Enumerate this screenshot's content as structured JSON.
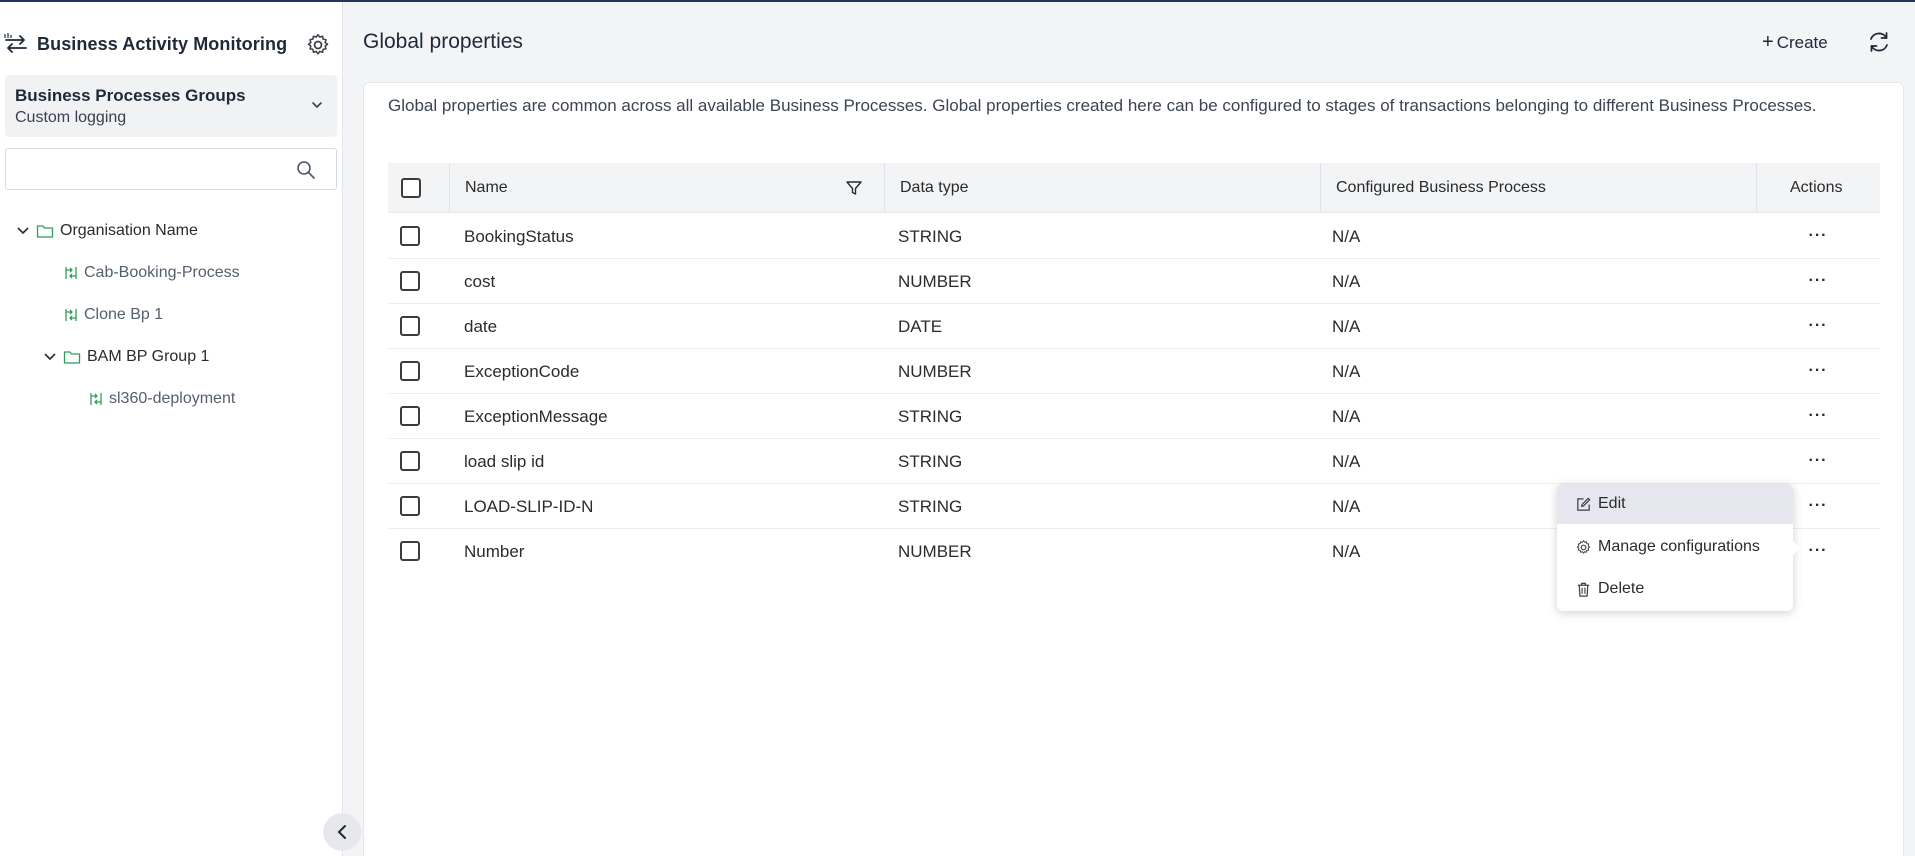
{
  "app": {
    "title": "Business Activity Monitoring",
    "accent_color": "#22355a",
    "bp_icon_color": "#2f9e5b"
  },
  "sidebar": {
    "group_selector": {
      "title": "Business Processes Groups",
      "subtitle": "Custom logging"
    },
    "search": {
      "placeholder": "",
      "value": ""
    },
    "tree": [
      {
        "label": "Organisation Name",
        "type": "folder",
        "expanded": true
      },
      {
        "label": "Cab-Booking-Process",
        "type": "business-process"
      },
      {
        "label": "Clone Bp 1",
        "type": "business-process"
      },
      {
        "label": "BAM BP Group 1",
        "type": "folder",
        "expanded": true
      },
      {
        "label": "sl360-deployment",
        "type": "business-process"
      }
    ]
  },
  "header": {
    "title": "Global properties",
    "create_label": "Create",
    "create_icon": "plus-icon",
    "refresh_icon": "refresh-icon"
  },
  "main": {
    "description": "Global properties are common across all available Business Processes. Global properties created here can be configured to stages of transactions belonging to different Business Processes.",
    "table": {
      "columns": [
        "Name",
        "Data type",
        "Configured Business Process",
        "Actions"
      ],
      "rows": [
        {
          "name": "BookingStatus",
          "type": "STRING",
          "bp": "N/A",
          "actions": "···"
        },
        {
          "name": "cost",
          "type": "NUMBER",
          "bp": "N/A",
          "actions": "···"
        },
        {
          "name": "date",
          "type": "DATE",
          "bp": "N/A",
          "actions": "···"
        },
        {
          "name": "ExceptionCode",
          "type": "NUMBER",
          "bp": "N/A",
          "actions": "···"
        },
        {
          "name": "ExceptionMessage",
          "type": "STRING",
          "bp": "N/A",
          "actions": "···"
        },
        {
          "name": "load slip id",
          "type": "STRING",
          "bp": "N/A",
          "actions": "···"
        },
        {
          "name": "LOAD-SLIP-ID-N",
          "type": "STRING",
          "bp": "N/A",
          "actions": "···"
        },
        {
          "name": "Number",
          "type": "NUMBER",
          "bp": "N/A",
          "actions": "···"
        }
      ]
    }
  },
  "context_menu": {
    "items": [
      {
        "label": "Edit",
        "icon": "edit-icon",
        "highlighted": true
      },
      {
        "label": "Manage configurations",
        "icon": "gear-icon"
      },
      {
        "label": "Delete",
        "icon": "trash-icon"
      }
    ]
  }
}
